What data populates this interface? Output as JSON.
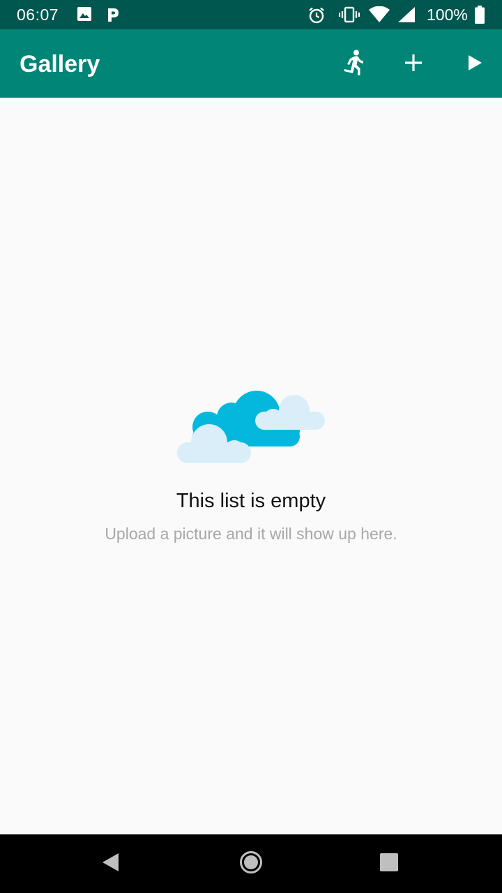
{
  "status_bar": {
    "time": "06:07",
    "battery_text": "100%",
    "icons": [
      "image-notification-icon",
      "p-notification-icon",
      "alarm-icon",
      "vibrate-icon",
      "wifi-icon",
      "cell-signal-icon",
      "battery-icon"
    ]
  },
  "app_bar": {
    "title": "Gallery",
    "actions": [
      "run-icon",
      "add-icon",
      "play-icon"
    ],
    "background_color": "#008577"
  },
  "empty_state": {
    "title": "This list is empty",
    "subtitle": "Upload a picture and it will show up here.",
    "illustration": "clouds-illustration"
  },
  "nav_bar": {
    "buttons": [
      "back-icon",
      "home-icon",
      "recents-icon"
    ]
  },
  "colors": {
    "status_bar": "#00574f",
    "primary": "#008577",
    "cloud_primary": "#03b8dc",
    "cloud_light": "#d9eef9",
    "background": "#fafafa"
  }
}
